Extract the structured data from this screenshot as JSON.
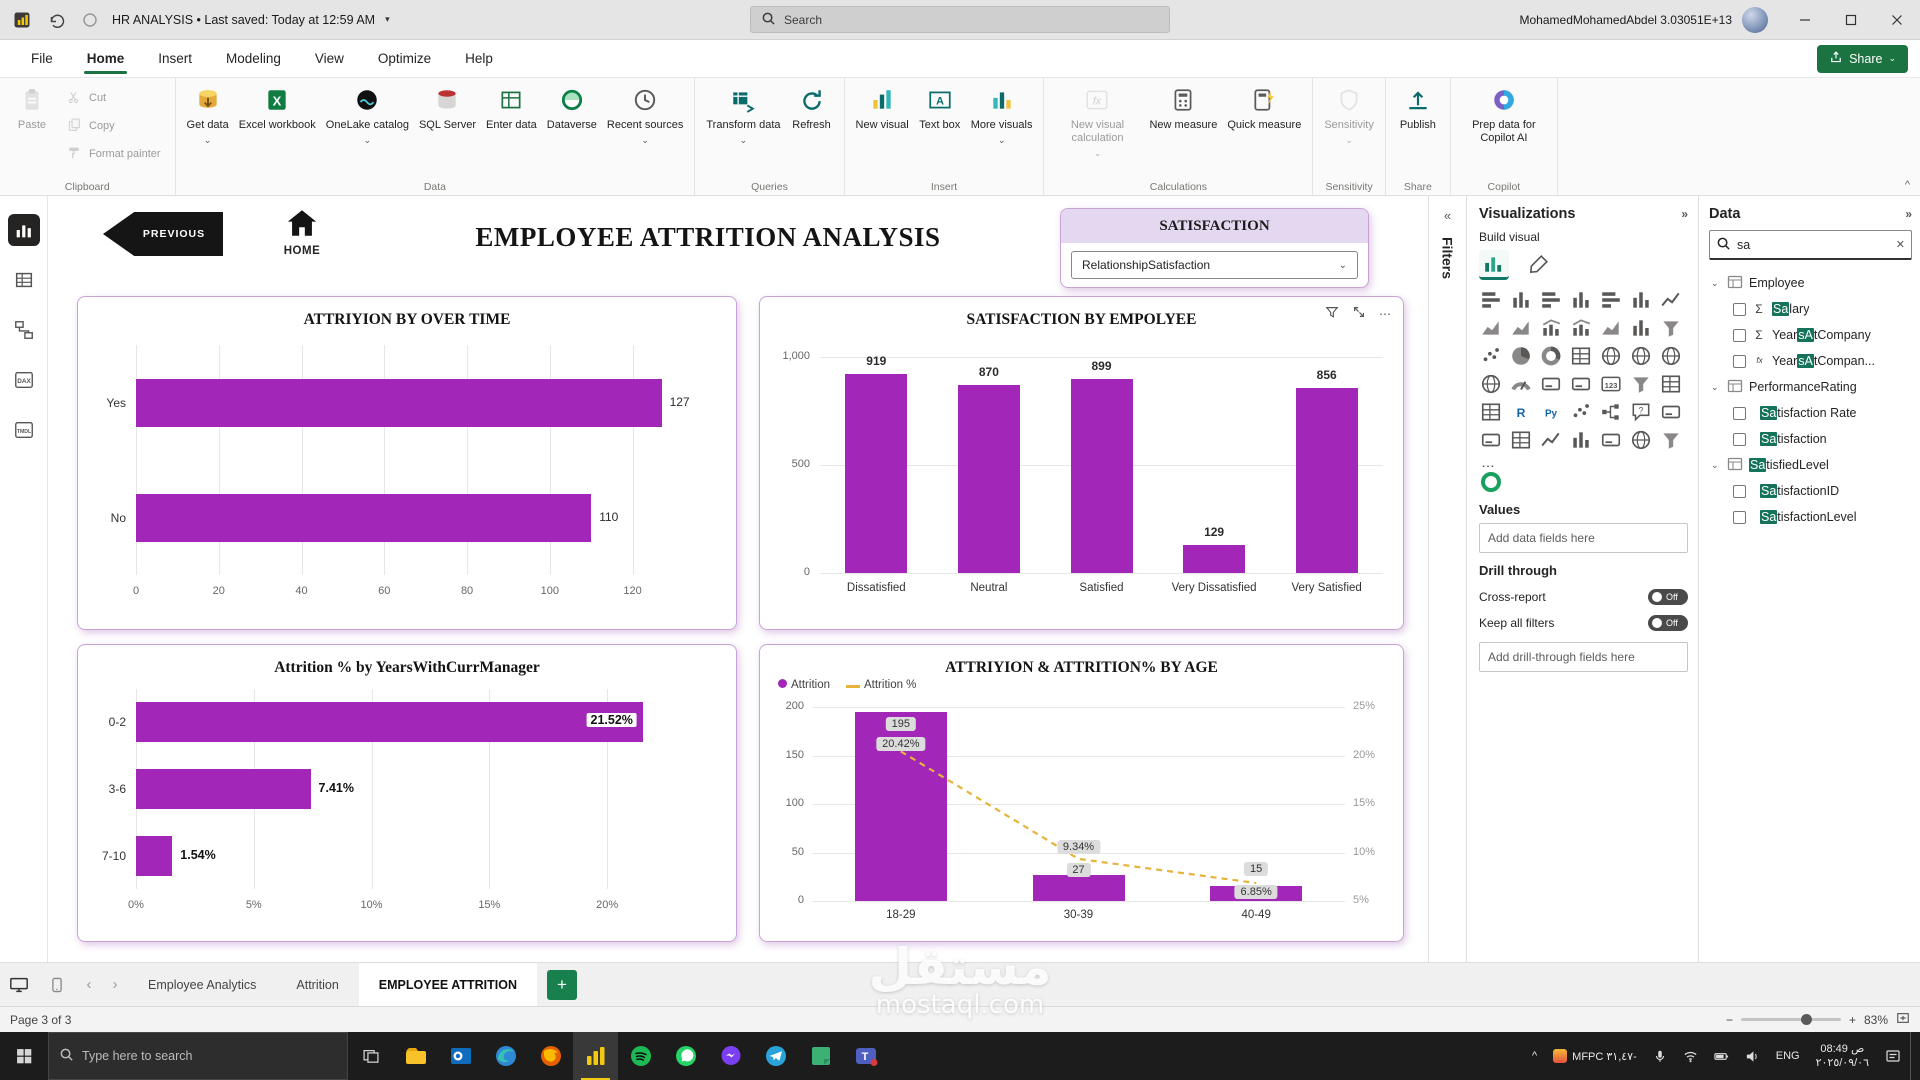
{
  "glyphs": {
    "chevron_down": "⌄",
    "chevrons_left": "«",
    "chevrons_right": "»",
    "caret_small": "▾",
    "dots": "⋯",
    "ellipsis": "…",
    "sigma": "Σ",
    "plus": "+",
    "minus": "−",
    "caret_up": "^",
    "nav_left": "‹",
    "nav_right": "›"
  },
  "window": {
    "title_full": "HR ANALYSIS  •  Last saved: Today at 12:59 AM",
    "search_placeholder": "Search",
    "user": "MohamedMohamedAbdel 3.03051E+13"
  },
  "menu": {
    "items": [
      "File",
      "Home",
      "Insert",
      "Modeling",
      "View",
      "Optimize",
      "Help"
    ],
    "active_index": 1,
    "share_label": "Share"
  },
  "ribbon": {
    "groups": [
      {
        "label": "Clipboard",
        "items": [
          {
            "label": "Paste",
            "icon": "paste",
            "kind": "large",
            "disabled": true
          },
          {
            "label": "Cut",
            "icon": "cut",
            "kind": "small",
            "disabled": true
          },
          {
            "label": "Copy",
            "icon": "copy",
            "kind": "small",
            "disabled": true
          },
          {
            "label": "Format painter",
            "icon": "format-painter",
            "kind": "small",
            "disabled": true
          }
        ]
      },
      {
        "label": "Data",
        "items": [
          {
            "label": "Get data",
            "icon": "get-data",
            "dropdown": true
          },
          {
            "label": "Excel workbook",
            "icon": "excel"
          },
          {
            "label": "OneLake catalog",
            "icon": "onelake",
            "dropdown": true
          },
          {
            "label": "SQL Server",
            "icon": "sql"
          },
          {
            "label": "Enter data",
            "icon": "enter-data"
          },
          {
            "label": "Dataverse",
            "icon": "dataverse"
          },
          {
            "label": "Recent sources",
            "icon": "recent",
            "dropdown": true
          }
        ]
      },
      {
        "label": "Queries",
        "items": [
          {
            "label": "Transform data",
            "icon": "transform",
            "dropdown": true
          },
          {
            "label": "Refresh",
            "icon": "refresh"
          }
        ]
      },
      {
        "label": "Insert",
        "items": [
          {
            "label": "New visual",
            "icon": "new-visual"
          },
          {
            "label": "Text box",
            "icon": "text-box"
          },
          {
            "label": "More visuals",
            "icon": "more-visuals",
            "dropdown": true
          }
        ]
      },
      {
        "label": "Calculations",
        "items": [
          {
            "label": "New visual calculation",
            "icon": "visual-calc",
            "dropdown": true,
            "disabled": true
          },
          {
            "label": "New measure",
            "icon": "new-measure"
          },
          {
            "label": "Quick measure",
            "icon": "quick-measure"
          }
        ]
      },
      {
        "label": "Sensitivity",
        "items": [
          {
            "label": "Sensitivity",
            "icon": "sensitivity",
            "dropdown": true,
            "disabled": true
          }
        ]
      },
      {
        "label": "Share",
        "items": [
          {
            "label": "Publish",
            "icon": "publish"
          }
        ]
      },
      {
        "label": "Copilot",
        "items": [
          {
            "label": "Prep data for Copilot AI",
            "icon": "copilot"
          }
        ]
      }
    ]
  },
  "left_rail": {
    "items": [
      "report-view",
      "table-view",
      "model-view",
      "dax-query-view",
      "tmdl-view"
    ],
    "active_index": 0
  },
  "report": {
    "previous_label": "PREVIOUS",
    "home_label": "HOME",
    "title": "EMPLOYEE ATTRITION ANALYSIS",
    "slicer": {
      "title": "SATISFACTION",
      "value": "RelationshipSatisfaction"
    }
  },
  "chart_data": [
    {
      "id": "attrition_by_overtime",
      "type": "bar",
      "orientation": "horizontal",
      "title": "ATTRIYION BY OVER TIME",
      "categories": [
        "Yes",
        "No"
      ],
      "values": [
        127,
        110
      ],
      "data_labels": [
        "127",
        "110"
      ],
      "xlim": [
        0,
        130
      ],
      "xticks": [
        0,
        20,
        40,
        60,
        80,
        100,
        120
      ],
      "xtick_labels": [
        "0",
        "20",
        "40",
        "60",
        "80",
        "100",
        "120"
      ],
      "bar_color": "#A227B8",
      "grid": true,
      "legend": false
    },
    {
      "id": "satisfaction_by_employee",
      "type": "bar",
      "title": "SATISFACTION BY EMPOLYEE",
      "categories": [
        "Dissatisfied",
        "Neutral",
        "Satisfied",
        "Very Dissatisfied",
        "Very Satisfied"
      ],
      "values": [
        919,
        870,
        899,
        129,
        856
      ],
      "data_labels": [
        "919",
        "870",
        "899",
        "129",
        "856"
      ],
      "ylim": [
        0,
        1000
      ],
      "yticks": [
        0,
        500,
        1000
      ],
      "ytick_labels": [
        "0",
        "500",
        "1,000"
      ],
      "bar_color": "#A227B8",
      "grid": true,
      "legend": false
    },
    {
      "id": "attrition_pct_by_years_with_curr_manager",
      "type": "bar",
      "orientation": "horizontal",
      "title": "Attrition % by YearsWithCurrManager",
      "categories": [
        "0-2",
        "3-6",
        "7-10"
      ],
      "values": [
        21.52,
        7.41,
        1.54
      ],
      "data_labels": [
        "21.52%",
        "7.41%",
        "1.54%"
      ],
      "label_inside": [
        true,
        false,
        false
      ],
      "xlim": [
        0,
        22.5
      ],
      "xticks": [
        0,
        5,
        10,
        15,
        20
      ],
      "xtick_labels": [
        "0%",
        "5%",
        "10%",
        "15%",
        "20%"
      ],
      "bar_color": "#A227B8",
      "grid": true,
      "legend": false
    },
    {
      "id": "attrition_and_pct_by_age",
      "type": "combo",
      "title": "ATTRIYION & ATTRITION% BY AGE",
      "categories": [
        "18-29",
        "30-39",
        "40-49"
      ],
      "series": [
        {
          "name": "Attrition",
          "type": "bar",
          "values": [
            195,
            27,
            15
          ],
          "data_labels": [
            "195",
            "27",
            "15"
          ],
          "color": "#A227B8"
        },
        {
          "name": "Attrition %",
          "type": "line",
          "values": [
            20.42,
            9.34,
            6.85
          ],
          "data_labels": [
            "20.42%",
            "9.34%",
            "6.85%"
          ],
          "color": "#E6B33D"
        }
      ],
      "left_ylim": [
        0,
        200
      ],
      "left_yticks": [
        0,
        50,
        100,
        150,
        200
      ],
      "left_ytick_labels": [
        "0",
        "50",
        "100",
        "150",
        "200"
      ],
      "right_ylim": [
        5,
        25
      ],
      "right_ytick_labels": [
        "5%",
        "10%",
        "15%",
        "20%",
        "25%"
      ],
      "legend_position": "top-left",
      "grid": true
    }
  ],
  "filters_panel": {
    "label": "Filters"
  },
  "visualizations": {
    "title": "Visualizations",
    "build_visual_label": "Build visual",
    "values_label": "Values",
    "add_fields_placeholder": "Add data fields here",
    "drill_through_label": "Drill through",
    "cross_report_label": "Cross-report",
    "keep_filters_label": "Keep all filters",
    "toggle_off_label": "Off",
    "add_drill_placeholder": "Add drill-through fields here",
    "more_label": "…",
    "visual_types": [
      {
        "name": "stacked-bar-chart",
        "kind": "bars-h"
      },
      {
        "name": "stacked-column-chart",
        "kind": "bars-v"
      },
      {
        "name": "clustered-bar-chart",
        "kind": "bars-h"
      },
      {
        "name": "clustered-column-chart",
        "kind": "bars-v"
      },
      {
        "name": "100-stacked-bar-chart",
        "kind": "bars-h"
      },
      {
        "name": "100-stacked-column-chart",
        "kind": "bars-v"
      },
      {
        "name": "line-chart",
        "kind": "line"
      },
      {
        "name": "area-chart",
        "kind": "area"
      },
      {
        "name": "stacked-area-chart",
        "kind": "area"
      },
      {
        "name": "line-and-stacked-column-chart",
        "kind": "combo"
      },
      {
        "name": "line-and-clustered-column-chart",
        "kind": "combo"
      },
      {
        "name": "ribbon-chart",
        "kind": "area"
      },
      {
        "name": "waterfall-chart",
        "kind": "bars-v"
      },
      {
        "name": "funnel-chart",
        "kind": "funnel"
      },
      {
        "name": "scatter-chart",
        "kind": "scatter"
      },
      {
        "name": "pie-chart",
        "kind": "pie"
      },
      {
        "name": "donut-chart",
        "kind": "donut"
      },
      {
        "name": "treemap",
        "kind": "grid"
      },
      {
        "name": "map",
        "kind": "globe"
      },
      {
        "name": "filled-map",
        "kind": "globe"
      },
      {
        "name": "shape-map",
        "kind": "globe"
      },
      {
        "name": "azure-map",
        "kind": "globe"
      },
      {
        "name": "gauge",
        "kind": "gauge"
      },
      {
        "name": "card",
        "kind": "card"
      },
      {
        "name": "multi-row-card",
        "kind": "card"
      },
      {
        "name": "kpi",
        "kind": "n123"
      },
      {
        "name": "slicer",
        "kind": "funnel"
      },
      {
        "name": "table",
        "kind": "grid"
      },
      {
        "name": "matrix",
        "kind": "grid"
      },
      {
        "name": "r-script-visual",
        "kind": "r"
      },
      {
        "name": "python-visual",
        "kind": "py"
      },
      {
        "name": "key-influencers",
        "kind": "scatter"
      },
      {
        "name": "decomposition-tree",
        "kind": "tree"
      },
      {
        "name": "qna-visual",
        "kind": "q"
      },
      {
        "name": "smart-narrative",
        "kind": "card"
      },
      {
        "name": "paginated-report",
        "kind": "card"
      },
      {
        "name": "power-apps-visual",
        "kind": "grid"
      },
      {
        "name": "power-automate-visual",
        "kind": "line"
      },
      {
        "name": "metrics-visual",
        "kind": "bars-v"
      },
      {
        "name": "pinned-visual",
        "kind": "card"
      },
      {
        "name": "arcgis-map",
        "kind": "globe"
      },
      {
        "name": "button-slicer",
        "kind": "funnel"
      }
    ]
  },
  "data_panel": {
    "title": "Data",
    "search_value": "sa",
    "tables": [
      {
        "name_parts": [
          "Employee",
          "",
          ""
        ],
        "fields": [
          {
            "icon": "sigma",
            "parts": [
              "",
              "Sa",
              "lary"
            ]
          },
          {
            "icon": "sigma",
            "parts": [
              "Year",
              "sA",
              "tCompany"
            ]
          },
          {
            "icon": "calc",
            "parts": [
              "Year",
              "sA",
              "tCompan..."
            ]
          }
        ]
      },
      {
        "name_parts": [
          "PerformanceRating",
          "",
          ""
        ],
        "fields": [
          {
            "icon": "none",
            "parts": [
              "",
              "Sa",
              "tisfaction Rate"
            ]
          },
          {
            "icon": "none",
            "parts": [
              "",
              "Sa",
              "tisfaction"
            ]
          }
        ]
      },
      {
        "name_parts": [
          "",
          "Sa",
          "tisfiedLevel"
        ],
        "fields": [
          {
            "icon": "none",
            "parts": [
              "",
              "Sa",
              "tisfactionID"
            ]
          },
          {
            "icon": "none",
            "parts": [
              "",
              "Sa",
              "tisfactionLevel"
            ]
          }
        ]
      }
    ]
  },
  "pages": {
    "tabs": [
      "Employee Analytics",
      "Attrition",
      "EMPLOYEE ATTRITION"
    ],
    "active_index": 2
  },
  "status": {
    "page_info": "Page 3 of 3",
    "zoom": "83%"
  },
  "taskbar": {
    "search_placeholder": "Type here to search",
    "apps": [
      "file-explorer",
      "outlook",
      "edge",
      "firefox",
      "power-bi",
      "spotify",
      "whatsapp",
      "messenger",
      "telegram",
      "notes",
      "teams"
    ],
    "active_app": "power-bi",
    "ticker": "MFPC ٣١,٤٧-",
    "language": "ENG",
    "time": "08:49 ص",
    "date": "٢٠٢٥/٠٩/٠٦"
  },
  "watermark": {
    "line1": "مستقل",
    "line2": "mostaql.com"
  }
}
